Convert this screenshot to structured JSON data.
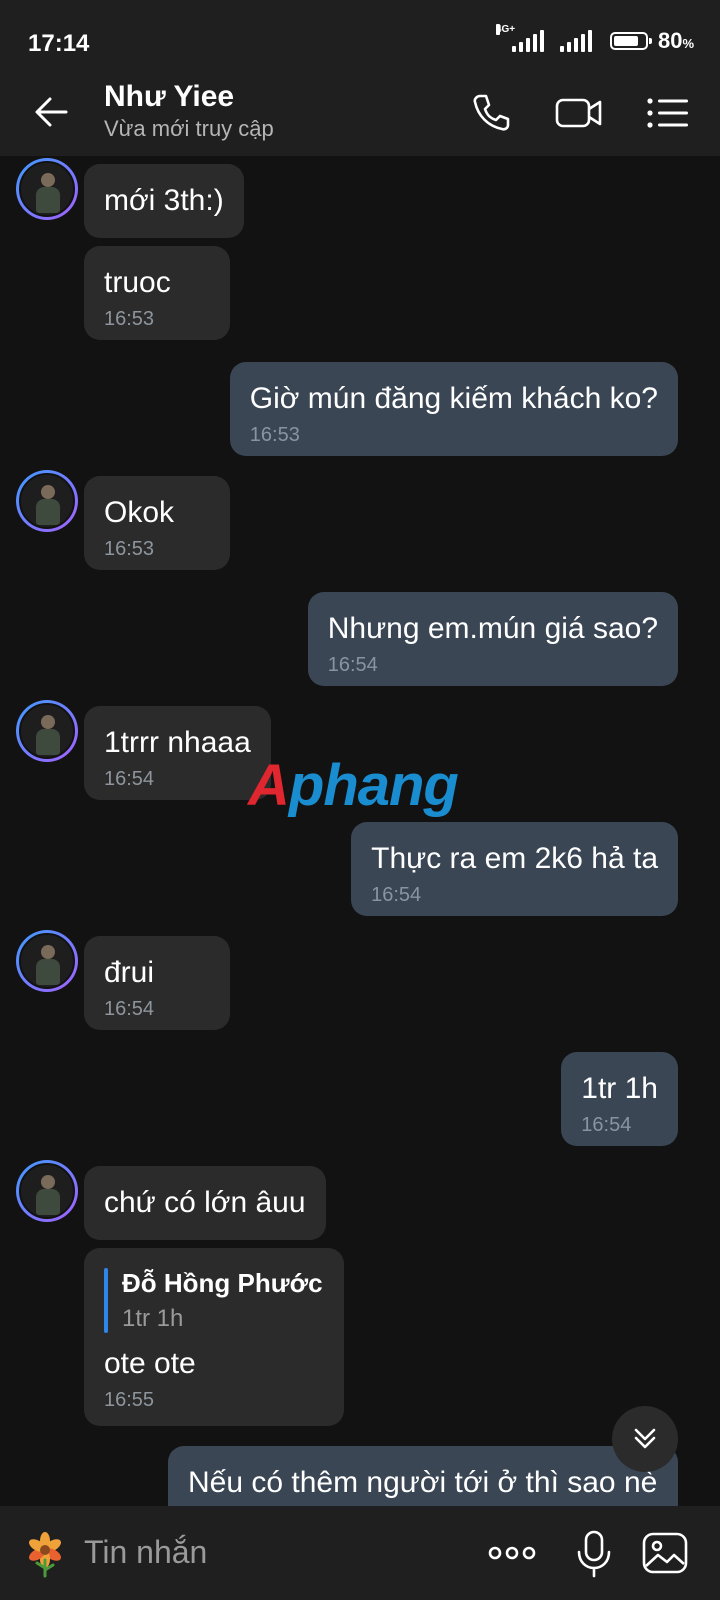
{
  "status": {
    "time": "17:14",
    "network": "4G+",
    "battery": "80",
    "battery_unit": "%",
    "battery_level": 0.8
  },
  "header": {
    "name": "Như Yiee",
    "subtitle": "Vừa mới truy cập"
  },
  "messages": [
    {
      "dir": "in",
      "text": "mới 3th:)",
      "time": ""
    },
    {
      "dir": "in",
      "text": "truoc",
      "time": "16:53"
    },
    {
      "dir": "out",
      "text": "Giờ mún đăng kiếm khách ko?",
      "time": "16:53"
    },
    {
      "dir": "in",
      "text": "Okok",
      "time": "16:53"
    },
    {
      "dir": "out",
      "text": "Nhưng em.mún giá sao?",
      "time": "16:54"
    },
    {
      "dir": "in",
      "text": "1trrr nhaaa",
      "time": "16:54"
    },
    {
      "dir": "out",
      "text": "Thực ra em 2k6 hả ta",
      "time": "16:54"
    },
    {
      "dir": "in",
      "text": "đrui",
      "time": "16:54"
    },
    {
      "dir": "out",
      "text": "1tr 1h",
      "time": "16:54"
    },
    {
      "dir": "in",
      "text": "chứ có lớn âuu",
      "time": ""
    },
    {
      "dir": "in",
      "quote_name": "Đỗ Hồng Phước",
      "quote_text": "1tr 1h",
      "text": "ote ote",
      "time": "16:55"
    },
    {
      "dir": "out",
      "text": "Nếu có thêm người tới ở thì sao nè",
      "time": ""
    }
  ],
  "watermark": {
    "prefix": "A",
    "rest": "phang"
  },
  "input": {
    "placeholder": "Tin nhắn"
  },
  "colors": {
    "incoming": "#2b2b2b",
    "outgoing": "#3a4654",
    "accent": "#2f86e9",
    "background": "#121212"
  }
}
